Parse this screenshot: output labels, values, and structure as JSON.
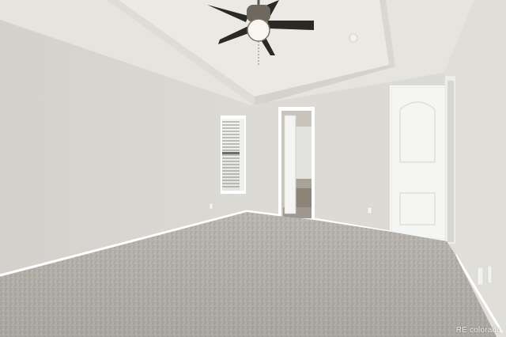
{
  "scene": {
    "subject": "empty-bedroom",
    "watermark": "RE colorado"
  },
  "colors": {
    "wall_left": "#d8d6d0",
    "wall_back": "#dcdad4",
    "wall_right": "#e2e0da",
    "ceiling": "#e9e7e2",
    "carpet": "#b9b5b0",
    "trim": "#ffffff",
    "door": "#f7f7f5"
  }
}
